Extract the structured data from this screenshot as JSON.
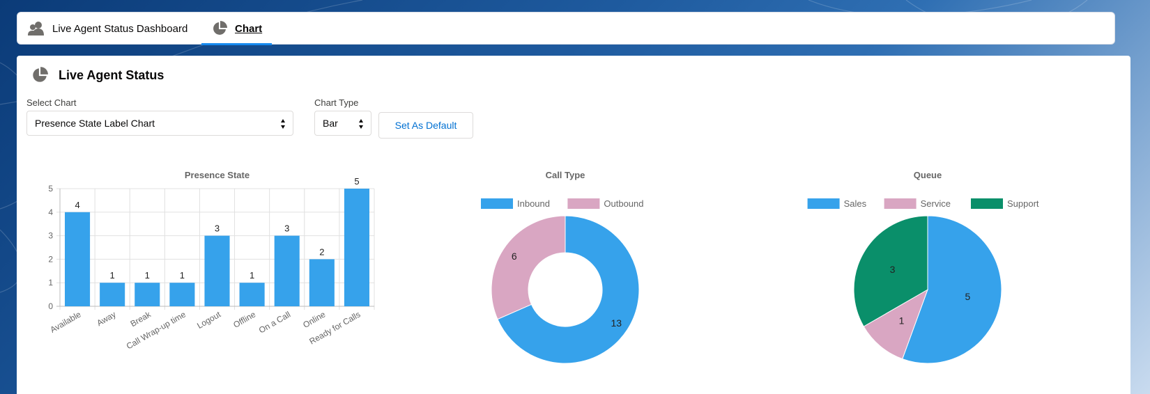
{
  "tabs": [
    {
      "label": "Live Agent Status Dashboard",
      "icon": "users-icon"
    },
    {
      "label": "Chart",
      "icon": "pie-chart-icon"
    }
  ],
  "panel": {
    "title": "Live Agent Status",
    "select_chart_label": "Select Chart",
    "select_chart_value": "Presence State Label Chart",
    "chart_type_label": "Chart Type",
    "chart_type_value": "Bar",
    "set_default_label": "Set As Default"
  },
  "colors": {
    "blue": "#36a2eb",
    "pink": "#d9a6c2",
    "green": "#0a8f6a"
  },
  "chart_data": [
    {
      "type": "bar",
      "title": "Presence State",
      "categories": [
        "Available",
        "Away",
        "Break",
        "Call Wrap-up time",
        "Logout",
        "Offline",
        "On a Call",
        "Online",
        "Ready for Calls"
      ],
      "values": [
        4,
        1,
        1,
        1,
        3,
        1,
        3,
        2,
        5
      ],
      "ylim": [
        0,
        5
      ],
      "yticks": [
        0,
        1,
        2,
        3,
        4,
        5
      ]
    },
    {
      "type": "pie",
      "title": "Call Type",
      "donut": true,
      "labels": [
        "Inbound",
        "Outbound"
      ],
      "values": [
        13,
        6
      ],
      "legend": "top"
    },
    {
      "type": "pie",
      "title": "Queue",
      "labels": [
        "Sales",
        "Service",
        "Support"
      ],
      "values": [
        5,
        1,
        3
      ],
      "legend": "top"
    }
  ]
}
